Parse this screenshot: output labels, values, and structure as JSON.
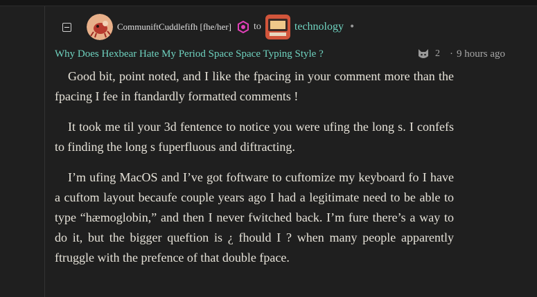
{
  "comment": {
    "author": "CommuniftCuddlefifh [fhe/her]",
    "to_word": "to",
    "community": "technology",
    "separator_dot": "•",
    "post_title": "Why Does Hexbear Hate My Period Space Space Typing Style ?",
    "reply_count": "2",
    "meta_sep": "·",
    "timestamp": "9 hours ago",
    "paragraphs": [
      "Good bit, point noted, and I like the fpacing in your comment more than the fpacing I fee in ftandardly formatted comments !",
      "It took me til your 3d fentence to notice you were ufing the long s.   I confefs to finding the long s fuperfluous and diftracting.",
      "I’m ufing MacOS and I’ve got foftware to cuftomize my keyboard fo I have a cuftom layout becaufe couple years ago I had a legitimate need to be able to type “hæmoglobin,” and then I never fwitched back.   I’m fure there’s a way to do it, but the bigger queftion is ¿ fhould I ?   when many people apparently ftruggle with the prefence of that double fpace."
    ]
  },
  "icons": {
    "collapse": "minus-square-icon",
    "user_badge": "hexagon-badge-icon",
    "mod": "cat-icon"
  },
  "colors": {
    "background": "#1f1f1f",
    "link": "#6fd3c0",
    "badge": "#e040b8",
    "text": "#e6e2d8",
    "muted": "#a7a7a7"
  }
}
